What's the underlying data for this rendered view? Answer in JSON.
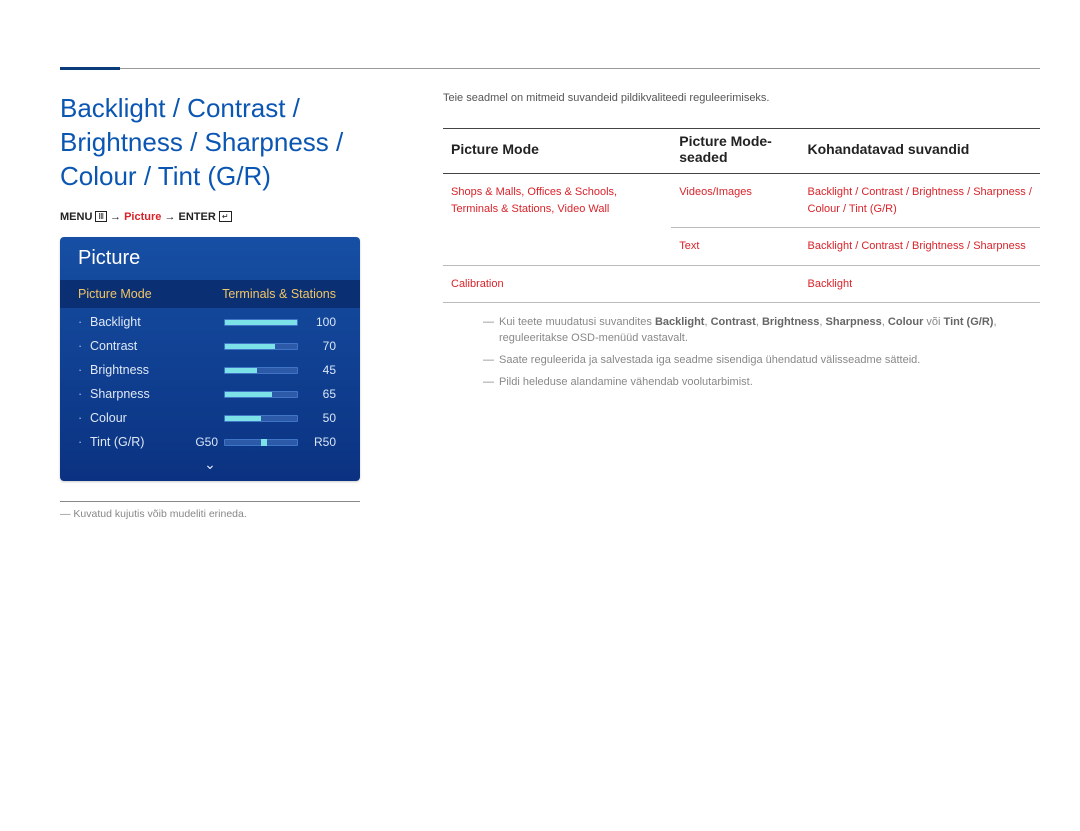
{
  "header": "Backlight / Contrast / Brightness / Sharpness / Colour / Tint (G/R)",
  "menu_path": {
    "menu": "MENU",
    "arrow": "→",
    "highlight": "Picture",
    "enter": "ENTER"
  },
  "osd": {
    "title": "Picture",
    "mode_label": "Picture Mode",
    "mode_value": "Terminals & Stations",
    "items": [
      {
        "label": "Backlight",
        "value": "100",
        "pct": 100
      },
      {
        "label": "Contrast",
        "value": "70",
        "pct": 70
      },
      {
        "label": "Brightness",
        "value": "45",
        "pct": 45
      },
      {
        "label": "Sharpness",
        "value": "65",
        "pct": 65
      },
      {
        "label": "Colour",
        "value": "50",
        "pct": 50
      }
    ],
    "tint": {
      "label": "Tint (G/R)",
      "g": "G50",
      "r": "R50",
      "pos": 50
    }
  },
  "footnote_left": "Kuvatud kujutis võib mudeliti erineda.",
  "intro": "Teie seadmel on mitmeid suvandeid pildikvaliteedi reguleerimiseks.",
  "table": {
    "headers": {
      "c1": "Picture Mode",
      "c2": "Picture Mode-seaded",
      "c3": "Kohandatavad suvandid"
    },
    "row1": {
      "c1": "Shops & Malls, Offices & Schools, Terminals & Stations, Video Wall",
      "c2": "Videos/Images",
      "c3": "Backlight / Contrast / Brightness / Sharpness / Colour / Tint (G/R)"
    },
    "row2": {
      "c2": "Text",
      "c3": "Backlight / Contrast / Brightness / Sharpness"
    },
    "row3": {
      "c1": "Calibration",
      "c3": "Backlight"
    }
  },
  "notes": {
    "n1a": "Kui teete muudatusi suvandites ",
    "n1b": "Backlight",
    "n1c": ", ",
    "n1d": "Contrast",
    "n1e": ", ",
    "n1f": "Brightness",
    "n1g": ", ",
    "n1h": "Sharpness",
    "n1i": ", ",
    "n1j": "Colour",
    "n1k": " või ",
    "n1l": "Tint (G/R)",
    "n1m": ", reguleeritakse OSD-menüüd vastavalt.",
    "n2": "Saate reguleerida ja salvestada iga seadme sisendiga ühendatud välisseadme sätteid.",
    "n3": "Pildi heleduse alandamine vähendab voolutarbimist."
  }
}
